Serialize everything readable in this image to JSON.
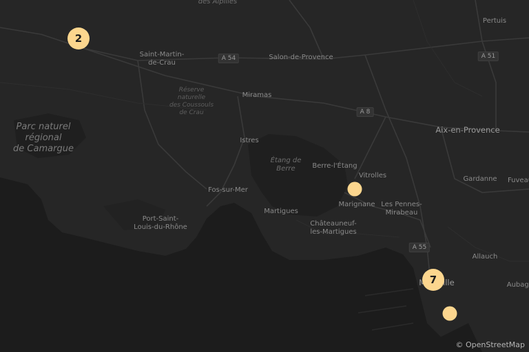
{
  "map": {
    "colors": {
      "land": "#262626",
      "sea": "#1c1c1c",
      "road": "#3a3a3a",
      "marker": "#fcd68e"
    },
    "labels": {
      "alpilles": "des Alpilles",
      "pertuis": "Pertuis",
      "saint_martin": "Saint-Martin-\nde-Crau",
      "salon": "Salon-de-Provence",
      "reserve": "Réserve\nnaturelle\ndes Coussouls\nde Crau",
      "miramas": "Miramas",
      "camargue": "Parc naturel\nrégional\nde Camargue",
      "aix": "Aix-en-Provence",
      "istres": "Istres",
      "etang_de_berre": "Étang de\nBerre",
      "berre": "Berre-l'Étang",
      "vitrolles": "Vitrolles",
      "gardanne": "Gardanne",
      "fuveau": "Fuveau",
      "fos": "Fos-sur-Mer",
      "marignane": "Marignane",
      "pennes": "Les Pennes-\nMirabeau",
      "martigues": "Martigues",
      "port_saint_louis": "Port-Saint-\nLouis-du-Rhône",
      "chateauneuf": "Châteauneuf-\nles-Martigues",
      "allauch": "Allauch",
      "marseille": "Marseille",
      "aubagne": "Aubagne"
    },
    "roads": {
      "a54": "A 54",
      "a51": "A 51",
      "a8": "A 8",
      "a55": "A 55"
    },
    "markers": [
      {
        "id": "cluster-arles",
        "type": "cluster",
        "count": "2"
      },
      {
        "id": "marker-marignane",
        "type": "single",
        "count": ""
      },
      {
        "id": "cluster-marseille",
        "type": "cluster",
        "count": "7"
      },
      {
        "id": "marker-marseille-south",
        "type": "single",
        "count": ""
      }
    ],
    "attribution": "© OpenStreetMap"
  }
}
